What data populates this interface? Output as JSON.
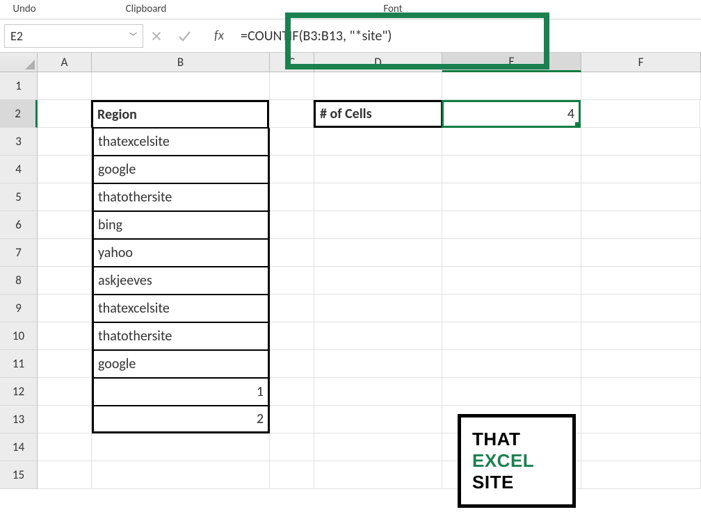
{
  "ribbon": {
    "undo": "Undo",
    "clipboard": "Clipboard",
    "font": "Font"
  },
  "nameBox": "E2",
  "fxLabel": "fx",
  "formula": "=COUNTIF(B3:B13, \"*site\")",
  "columns": [
    "A",
    "B",
    "C",
    "D",
    "E",
    "F"
  ],
  "rows": [
    "1",
    "2",
    "3",
    "4",
    "5",
    "6",
    "7",
    "8",
    "9",
    "10",
    "11",
    "12",
    "13",
    "14",
    "15"
  ],
  "table": {
    "header": "Region",
    "values": [
      "thatexcelsite",
      "google",
      "thatothersite",
      "bing",
      "yahoo",
      "askjeeves",
      "thatexcelsite",
      "thatothersite",
      "google",
      "1",
      "2"
    ]
  },
  "countLabel": "# of Cells",
  "countValue": "4",
  "logo": {
    "line1": "THAT",
    "line2": "EXCEL",
    "line3": "SITE"
  },
  "chart_data": {
    "type": "table",
    "title": "Region",
    "categories": [
      "thatexcelsite",
      "google",
      "thatothersite",
      "bing",
      "yahoo",
      "askjeeves",
      "thatexcelsite",
      "thatothersite",
      "google",
      "1",
      "2"
    ],
    "result_label": "# of Cells",
    "result_value": 4,
    "formula": "=COUNTIF(B3:B13, \"*site\")"
  }
}
